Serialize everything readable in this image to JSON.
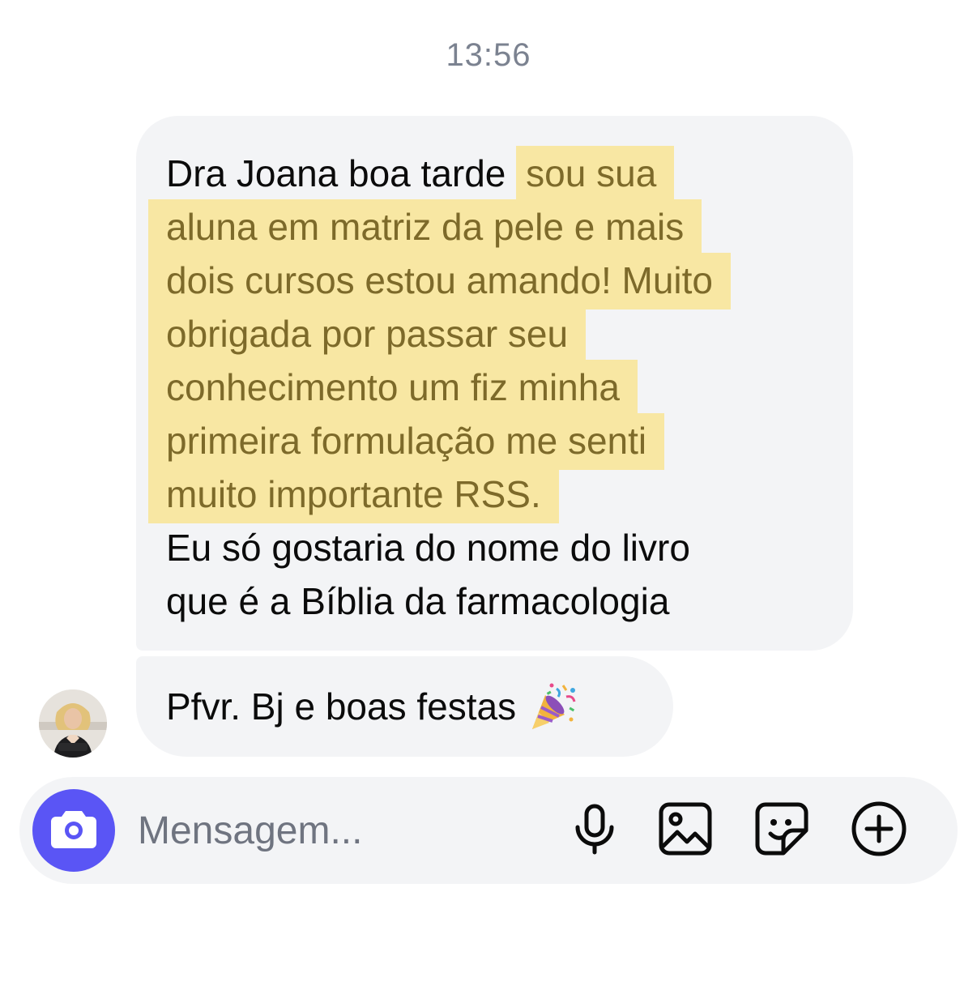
{
  "timestamp": "13:56",
  "message_main": {
    "lines": [
      {
        "normal": "Dra Joana boa tarde",
        "highlight": "sou sua"
      },
      {
        "highlight": "aluna em matriz da pele e mais"
      },
      {
        "highlight": "dois cursos estou amando! Muito"
      },
      {
        "highlight": "obrigada por passar seu"
      },
      {
        "highlight": "conhecimento um fiz minha"
      },
      {
        "highlight": "primeira formulação me senti"
      },
      {
        "highlight": "muito importante RSS."
      },
      {
        "normal": "Eu só gostaria do nome do livro"
      },
      {
        "normal": "que é a Bíblia da farmacologia"
      }
    ]
  },
  "message_second": {
    "text": "Pfvr. Bj e boas festas",
    "emoji": "party-popper"
  },
  "composer": {
    "placeholder": "Mensagem...",
    "value": ""
  },
  "colors": {
    "bubble": "#f3f4f6",
    "highlight": "#f8e7a3",
    "highlight_text": "#7d6a2a",
    "camera_button": "#5a55f5",
    "timestamp": "#7b8290"
  }
}
